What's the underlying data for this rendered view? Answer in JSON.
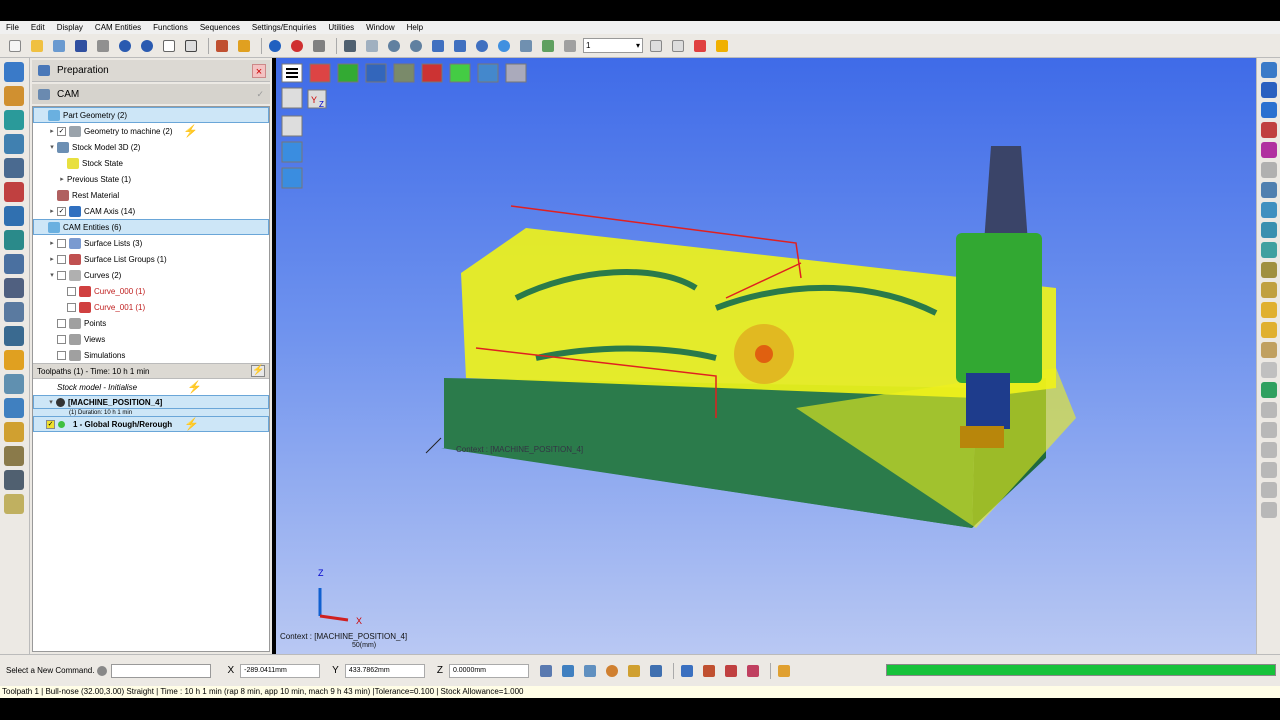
{
  "menu": [
    "File",
    "Edit",
    "Display",
    "CAM Entities",
    "Functions",
    "Sequences",
    "Settings/Enquiries",
    "Utilities",
    "Window",
    "Help"
  ],
  "toolbar": {
    "layer_value": "1"
  },
  "panel": {
    "title": "Preparation",
    "section": "CAM",
    "tree": [
      {
        "label": "Part Geometry (2)",
        "indent": 0,
        "exp": "",
        "cb": "",
        "icon": "#6ab0e0",
        "sel": true,
        "icon_name": "part-geometry-icon"
      },
      {
        "label": "Geometry to machine (2)",
        "indent": 1,
        "exp": "▸",
        "cb": "✓",
        "icon": "#9aa3ab",
        "flash": true,
        "icon_name": "geometry-icon"
      },
      {
        "label": "Stock Model 3D (2)",
        "indent": 1,
        "exp": "▾",
        "cb": "",
        "icon": "#6c8fb3",
        "icon_name": "stock-model-icon"
      },
      {
        "label": "Stock State",
        "indent": 2,
        "exp": "",
        "cb": "",
        "icon": "#e8e040",
        "icon_name": "stock-state-icon"
      },
      {
        "label": "Previous State (1)",
        "indent": 2,
        "exp": "▸",
        "cb": "",
        "icon": "",
        "icon_name": ""
      },
      {
        "label": "Rest Material",
        "indent": 1,
        "exp": "",
        "cb": "",
        "icon": "#b06060",
        "icon_name": "rest-material-icon"
      },
      {
        "label": "CAM Axis (14)",
        "indent": 1,
        "exp": "▸",
        "cb": "✓",
        "icon": "#3070c0",
        "icon_name": "cam-axis-icon"
      },
      {
        "label": "CAM Entities (6)",
        "indent": 0,
        "exp": "",
        "cb": "",
        "icon": "#6ab0e0",
        "sel": true,
        "icon_name": "cam-entities-icon"
      },
      {
        "label": "Surface Lists (3)",
        "indent": 1,
        "exp": "▸",
        "cb": " ",
        "icon": "#7a9ad0",
        "icon_name": "surface-list-icon"
      },
      {
        "label": "Surface List Groups (1)",
        "indent": 1,
        "exp": "▸",
        "cb": " ",
        "icon": "#c05050",
        "icon_name": "surface-group-icon"
      },
      {
        "label": "Curves (2)",
        "indent": 1,
        "exp": "▾",
        "cb": " ",
        "icon": "#b0b0b0",
        "icon_name": "curves-icon"
      },
      {
        "label": "Curve_000 (1)",
        "indent": 2,
        "exp": "",
        "cb": " ",
        "icon": "#d04040",
        "red": true,
        "icon_name": "curve-icon"
      },
      {
        "label": "Curve_001 (1)",
        "indent": 2,
        "exp": "",
        "cb": " ",
        "icon": "#d04040",
        "red": true,
        "icon_name": "curve-icon"
      },
      {
        "label": "Points",
        "indent": 1,
        "exp": "",
        "cb": " ",
        "icon": "#a0a0a0",
        "icon_name": "points-icon"
      },
      {
        "label": "Views",
        "indent": 1,
        "exp": "",
        "cb": " ",
        "icon": "#a0a0a0",
        "icon_name": "views-icon"
      },
      {
        "label": "Simulations",
        "indent": 1,
        "exp": "",
        "cb": " ",
        "icon": "#a0a0a0",
        "icon_name": "simulations-icon"
      }
    ],
    "toolpath_header": "Toolpaths (1) - Time: 10 h 1 min",
    "stock_init": "Stock model - Initialise",
    "machine_position": "[MACHINE_POSITION_4]",
    "duration": "(1) Duration: 10 h 1 min",
    "toolpath_item": "1 - Global Rough/Rerough"
  },
  "viewport": {
    "context_label": "Context : [MACHINE_POSITION_4]",
    "context_small": "Context : [MACHINE_POSITION_4]",
    "scale": "50(mm)",
    "axis_x": "X",
    "axis_y": "Y",
    "axis_z": "Z",
    "triad_y": "Y",
    "triad_z": "Z"
  },
  "cmd": {
    "label": "Select a New Command.",
    "x_label": "X",
    "x_value": "-289.0411mm",
    "y_label": "Y",
    "y_value": "433.7862mm",
    "z_label": "Z",
    "z_value": "0.0000mm"
  },
  "progress": {
    "value": 1.0
  },
  "status_text": "Toolpath 1 | Bull-nose (32.00,3.00) Straight | Time : 10 h 1 min (rap 8 min, app 10 min, mach 9 h 43 min) |Tolerance=0.100 | Stock Allowance=1.000",
  "colors": {
    "stock": "#2a7a4a",
    "toolpath": "#f0f21a",
    "holder": "#32a832",
    "spindle": "#1e3c8c",
    "cone": "#3a4468",
    "tip": "#b8860b",
    "accent": "#16c23a"
  }
}
